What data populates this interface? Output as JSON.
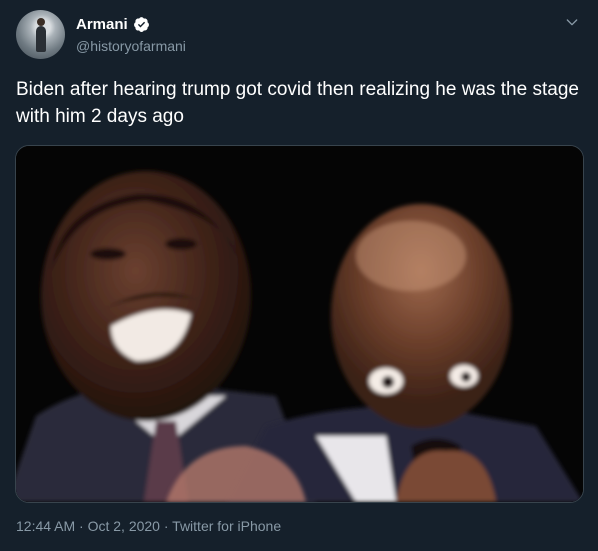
{
  "tweet": {
    "author_name": "Armani",
    "handle": "@historyofarmani",
    "text": "Biden after hearing trump got covid then realizing he was the stage with him 2 days ago",
    "timestamp": "12:44 AM · Oct 2, 2020 · ",
    "source": "Twitter for iPhone"
  },
  "icons": {
    "verified": "verified-badge-icon",
    "menu": "chevron-down-icon"
  },
  "colors": {
    "background": "#15202b",
    "secondary_text": "#8899a6",
    "accent": "#1da1f2"
  }
}
